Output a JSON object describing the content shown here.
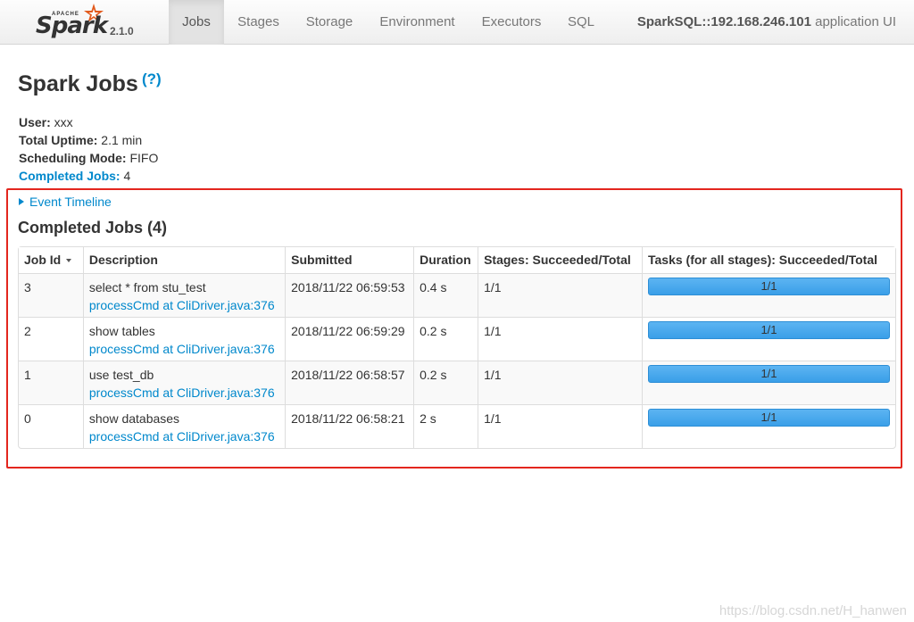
{
  "brand": {
    "apache": "APACHE",
    "name": "Spark",
    "version": "2.1.0"
  },
  "nav": {
    "tabs": [
      {
        "label": "Jobs",
        "active": true
      },
      {
        "label": "Stages",
        "active": false
      },
      {
        "label": "Storage",
        "active": false
      },
      {
        "label": "Environment",
        "active": false
      },
      {
        "label": "Executors",
        "active": false
      },
      {
        "label": "SQL",
        "active": false
      }
    ],
    "app_name": "SparkSQL::192.168.246.101",
    "app_suffix": " application UI"
  },
  "page": {
    "title": "Spark Jobs",
    "help": "(?)"
  },
  "summary": {
    "user_label": "User:",
    "user_value": " xxx",
    "uptime_label": "Total Uptime:",
    "uptime_value": " 2.1 min",
    "scheduling_label": "Scheduling Mode:",
    "scheduling_value": " FIFO",
    "completed_label": "Completed Jobs:",
    "completed_value": " 4"
  },
  "event_timeline": "Event Timeline",
  "completed_section_title": "Completed Jobs (4)",
  "table": {
    "headers": [
      "Job Id",
      "Description",
      "Submitted",
      "Duration",
      "Stages: Succeeded/Total",
      "Tasks (for all stages): Succeeded/Total"
    ],
    "rows": [
      {
        "id": "3",
        "desc": "select * from stu_test",
        "link": "processCmd at CliDriver.java:376",
        "submitted": "2018/11/22 06:59:53",
        "duration": "0.4 s",
        "stages": "1/1",
        "tasks": "1/1",
        "task_fraction": 1.0
      },
      {
        "id": "2",
        "desc": "show tables",
        "link": "processCmd at CliDriver.java:376",
        "submitted": "2018/11/22 06:59:29",
        "duration": "0.2 s",
        "stages": "1/1",
        "tasks": "1/1",
        "task_fraction": 1.0
      },
      {
        "id": "1",
        "desc": "use test_db",
        "link": "processCmd at CliDriver.java:376",
        "submitted": "2018/11/22 06:58:57",
        "duration": "0.2 s",
        "stages": "1/1",
        "tasks": "1/1",
        "task_fraction": 1.0
      },
      {
        "id": "0",
        "desc": "show databases",
        "link": "processCmd at CliDriver.java:376",
        "submitted": "2018/11/22 06:58:21",
        "duration": "2 s",
        "stages": "1/1",
        "tasks": "1/1",
        "task_fraction": 1.0
      }
    ]
  },
  "watermark": "https://blog.csdn.net/H_hanwen",
  "colors": {
    "link": "#0088cc",
    "progress": "#3ea3ec",
    "highlight": "#e3261e"
  }
}
